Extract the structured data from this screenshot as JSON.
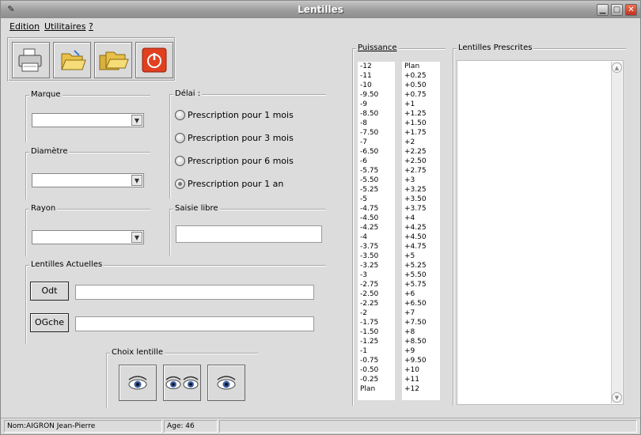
{
  "window": {
    "title": "Lentilles"
  },
  "menu": [
    "Edition",
    "Utilitaires",
    "?"
  ],
  "form": {
    "marque_label": "Marque",
    "diametre_label": "Diamètre",
    "rayon_label": "Rayon",
    "delai_label": "Délai :",
    "saisie_label": "Saisie libre",
    "lentilles_actuelles_label": "Lentilles Actuelles",
    "odt_label": "Odt",
    "ogche_label": "OGche",
    "choix_label": "Choix lentille",
    "radios": [
      {
        "label": "Prescription pour 1 mois",
        "checked": false
      },
      {
        "label": "Prescription pour 3 mois",
        "checked": false
      },
      {
        "label": "Prescription pour 6 mois",
        "checked": false
      },
      {
        "label": "Prescription pour 1 an",
        "checked": true
      }
    ]
  },
  "puissance": {
    "label": "Puissance",
    "minus": [
      "-12",
      "-11",
      "-10",
      "-9.50",
      "-9",
      "-8.50",
      "-8",
      "-7.50",
      "-7",
      "-6.50",
      "-6",
      "-5.75",
      "-5.50",
      "-5.25",
      "-5",
      "-4.75",
      "-4.50",
      "-4.25",
      "-4",
      "-3.75",
      "-3.50",
      "-3.25",
      "-3",
      "-2.75",
      "-2.50",
      "-2.25",
      "-2",
      "-1.75",
      "-1.50",
      "-1.25",
      "-1",
      "-0.75",
      "-0.50",
      "-0.25",
      "Plan"
    ],
    "plus": [
      "Plan",
      "+0.25",
      "+0.50",
      "+0.75",
      "+1",
      "+1.25",
      "+1.50",
      "+1.75",
      "+2",
      "+2.25",
      "+2.50",
      "+2.75",
      "+3",
      "+3.25",
      "+3.50",
      "+3.75",
      "+4",
      "+4.25",
      "+4.50",
      "+4.75",
      "+5",
      "+5.25",
      "+5.50",
      "+5.75",
      "+6",
      "+6.50",
      "+7",
      "+7.50",
      "+8",
      "+8.50",
      "+9",
      "+9.50",
      "+10",
      "+11",
      "+12"
    ]
  },
  "prescrites": {
    "label": "Lentilles Prescrites"
  },
  "status": {
    "nom": "Nom:AIGRON Jean-Pierre",
    "age": "Age: 46"
  },
  "colors": {
    "exit_button": "#e04020",
    "folder": "#f0d060",
    "eye_iris": "#3a5fa8"
  },
  "icons": {
    "print": "printer-icon",
    "open": "folder-open-icon",
    "open2": "folder-open-multiple-icon",
    "exit": "power-icon"
  }
}
